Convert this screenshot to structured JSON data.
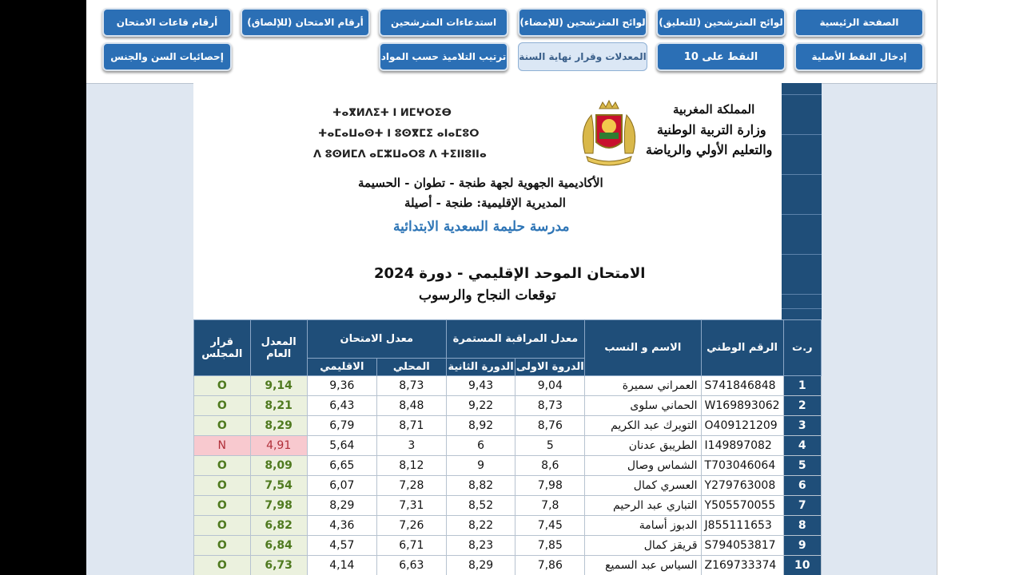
{
  "toolbar": {
    "row1": [
      "الصفحة الرئيسية",
      "لوائح المترشحين (للتعليق)",
      "لوائح المترشحين (للإمضاء)",
      "استدعاءات المترشحين",
      "أرقام الامتحان (للإلصاق)",
      "أرقام قاعات الامتحان"
    ],
    "row2": [
      "إدخال النقط الأصلية",
      "النقط على 10",
      "المعدلات وقرار نهاية السنة",
      "ترتيب التلاميذ حسب المواد",
      "إحصائيات السن والجنس"
    ]
  },
  "header": {
    "kingdom": "المملكة المغربية",
    "ministry1": "وزارة التربية الوطنية",
    "ministry2": "والتعليم الأولي والرياضة",
    "tif1": "ⵜⴰⴳⵍⴷⵉⵜ ⵏ ⵍⵎⵖⵔⵉⴱ",
    "tif2": "ⵜⴰⵎⴰⵡⴰⵙⵜ ⵏ ⵓⵙⴳⵎⵉ ⴰⵏⴰⵎⵓⵔ",
    "tif3": "ⴷ ⵓⵙⵍⵎⴷ ⴰⵎⵣⵡⴰⵔⵓ ⴷ ⵜⵉⵏⵏⵓⵏⵏⴰ",
    "academy": "الأكاديمية الجهوية لجهة طنجة - تطوان - الحسيمة",
    "directorate": "المديرية الإقليمية: طنجة - أصيلة",
    "school": "مدرسة حليمة السعدية الابتدائية",
    "exam": "الامتحان الموحد الإقليمي - دورة 2024",
    "subtitle": "توقعات النجاح والرسوب"
  },
  "table": {
    "headers": {
      "rt": "ر.ت",
      "id": "الرقم الوطني",
      "name": "الاسم و النسب",
      "cc": "معدل المراقبة المستمرة",
      "cc1": "الدروة الاولى",
      "cc2": "الدورة الثانية",
      "exam": "معدل الامتحان",
      "local": "المحلي",
      "regional": "الاقليمي",
      "avg1": "المعدل",
      "avg2": "العام",
      "dec1": "قرار",
      "dec2": "المجلس"
    },
    "rows": [
      {
        "rt": "1",
        "id": "S741846848",
        "name": "العمراني سميرة",
        "s1": "9,04",
        "s2": "9,43",
        "local": "8,73",
        "regional": "9,36",
        "avg": "9,14",
        "dec": "O",
        "fail": false
      },
      {
        "rt": "2",
        "id": "W169893062",
        "name": "الحماني سلوى",
        "s1": "8,73",
        "s2": "9,22",
        "local": "8,48",
        "regional": "6,43",
        "avg": "8,21",
        "dec": "O",
        "fail": false
      },
      {
        "rt": "3",
        "id": "O409121209",
        "name": "التويرك عبد الكريم",
        "s1": "8,76",
        "s2": "8,92",
        "local": "8,71",
        "regional": "6,79",
        "avg": "8,29",
        "dec": "O",
        "fail": false
      },
      {
        "rt": "4",
        "id": "I149897082",
        "name": "الطريبق عدنان",
        "s1": "5",
        "s2": "6",
        "local": "3",
        "regional": "5,64",
        "avg": "4,91",
        "dec": "N",
        "fail": true
      },
      {
        "rt": "5",
        "id": "T703046064",
        "name": "الشماس وصال",
        "s1": "8,6",
        "s2": "9",
        "local": "8,12",
        "regional": "6,65",
        "avg": "8,09",
        "dec": "O",
        "fail": false
      },
      {
        "rt": "6",
        "id": "Y279763008",
        "name": "العسري كمال",
        "s1": "7,98",
        "s2": "8,82",
        "local": "7,28",
        "regional": "6,07",
        "avg": "7,54",
        "dec": "O",
        "fail": false
      },
      {
        "rt": "7",
        "id": "Y505570055",
        "name": "التباري عبد الرحيم",
        "s1": "7,8",
        "s2": "8,52",
        "local": "7,31",
        "regional": "8,29",
        "avg": "7,98",
        "dec": "O",
        "fail": false
      },
      {
        "rt": "8",
        "id": "J855111653",
        "name": "الدبوز أسامة",
        "s1": "7,45",
        "s2": "8,22",
        "local": "7,26",
        "regional": "4,36",
        "avg": "6,82",
        "dec": "O",
        "fail": false
      },
      {
        "rt": "9",
        "id": "S794053817",
        "name": "قريقز كمال",
        "s1": "7,85",
        "s2": "8,23",
        "local": "6,71",
        "regional": "4,57",
        "avg": "6,84",
        "dec": "O",
        "fail": false
      },
      {
        "rt": "10",
        "id": "Z169733374",
        "name": "السياس عبد السميع",
        "s1": "7,86",
        "s2": "8,29",
        "local": "6,63",
        "regional": "4,14",
        "avg": "6,73",
        "dec": "O",
        "fail": false
      }
    ]
  },
  "colors": {
    "header_blue": "#1f4e79",
    "button_blue": "#2b6fb5",
    "pass_green": "#4f7a1f",
    "fail_red": "#b0303a",
    "school_blue": "#2e75b6"
  }
}
